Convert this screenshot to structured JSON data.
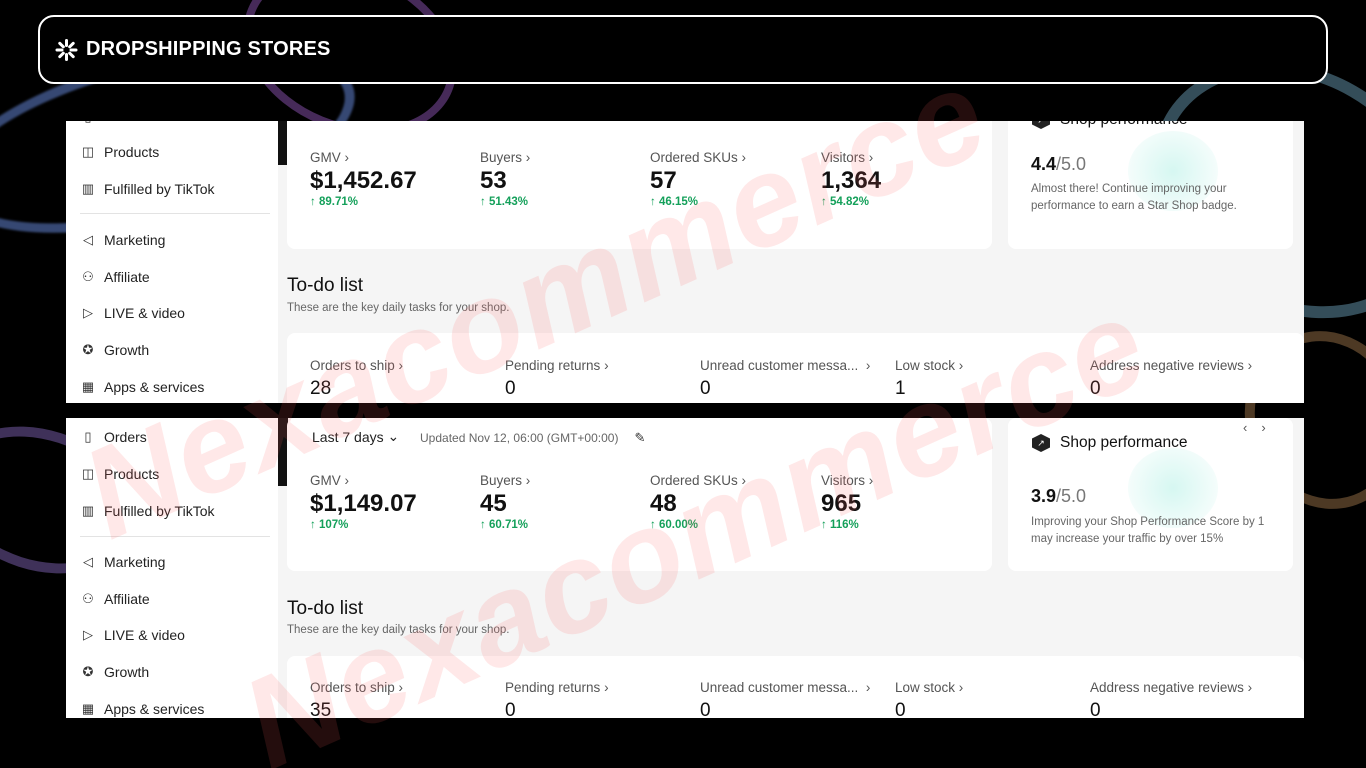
{
  "banner": {
    "title": "DROPSHIPPING STORES",
    "logo_icon": "sunburst-icon"
  },
  "watermark": "Nexacommerce",
  "panels": [
    {
      "sidebar": [
        "",
        "Products",
        "Fulfilled by TikTok",
        "Marketing",
        "Affiliate",
        "LIVE & video",
        "Growth",
        "Apps & services"
      ],
      "metrics": [
        {
          "label": "GMV",
          "value": "$1,452.67",
          "change": "89.71%"
        },
        {
          "label": "Buyers",
          "value": "53",
          "change": "51.43%"
        },
        {
          "label": "Ordered SKUs",
          "value": "57",
          "change": "46.15%"
        },
        {
          "label": "Visitors",
          "value": "1,364",
          "change": "54.82%"
        }
      ],
      "shop_performance": {
        "title": "Shop performance",
        "score": "4.4",
        "max": "/5.0",
        "text": "Almost there! Continue improving your performance to earn a Star Shop badge."
      },
      "todo": {
        "title": "To-do list",
        "subtitle": "These are the key daily tasks for your shop.",
        "items": [
          {
            "label": "Orders to ship",
            "value": "28"
          },
          {
            "label": "Pending returns",
            "value": "0"
          },
          {
            "label": "Unread customer messa...",
            "value": "0"
          },
          {
            "label": "Low stock",
            "value": "1"
          },
          {
            "label": "Address negative reviews",
            "value": "0"
          }
        ]
      }
    },
    {
      "range": "Last 7 days",
      "updated": "Updated Nov 12, 06:00 (GMT+00:00)",
      "sidebar": [
        "Orders",
        "Products",
        "Fulfilled by TikTok",
        "Marketing",
        "Affiliate",
        "LIVE & video",
        "Growth",
        "Apps & services"
      ],
      "metrics": [
        {
          "label": "GMV",
          "value": "$1,149.07",
          "change": "107%"
        },
        {
          "label": "Buyers",
          "value": "45",
          "change": "60.71%"
        },
        {
          "label": "Ordered SKUs",
          "value": "48",
          "change": "60.00%"
        },
        {
          "label": "Visitors",
          "value": "965",
          "change": "116%"
        }
      ],
      "shop_performance": {
        "title": "Shop performance",
        "score": "3.9",
        "max": "/5.0",
        "text": "Improving your Shop Performance Score by 1 may increase your traffic by over 15%"
      },
      "todo": {
        "title": "To-do list",
        "subtitle": "These are the key daily tasks for your shop.",
        "items": [
          {
            "label": "Orders to ship",
            "value": "35"
          },
          {
            "label": "Pending returns",
            "value": "0"
          },
          {
            "label": "Unread customer messa...",
            "value": "0"
          },
          {
            "label": "Low stock",
            "value": "0"
          },
          {
            "label": "Address negative reviews",
            "value": "0"
          }
        ]
      }
    }
  ],
  "colors": {
    "positive": "#14a05a",
    "background": "#000000",
    "panel": "#f5f5f5"
  }
}
